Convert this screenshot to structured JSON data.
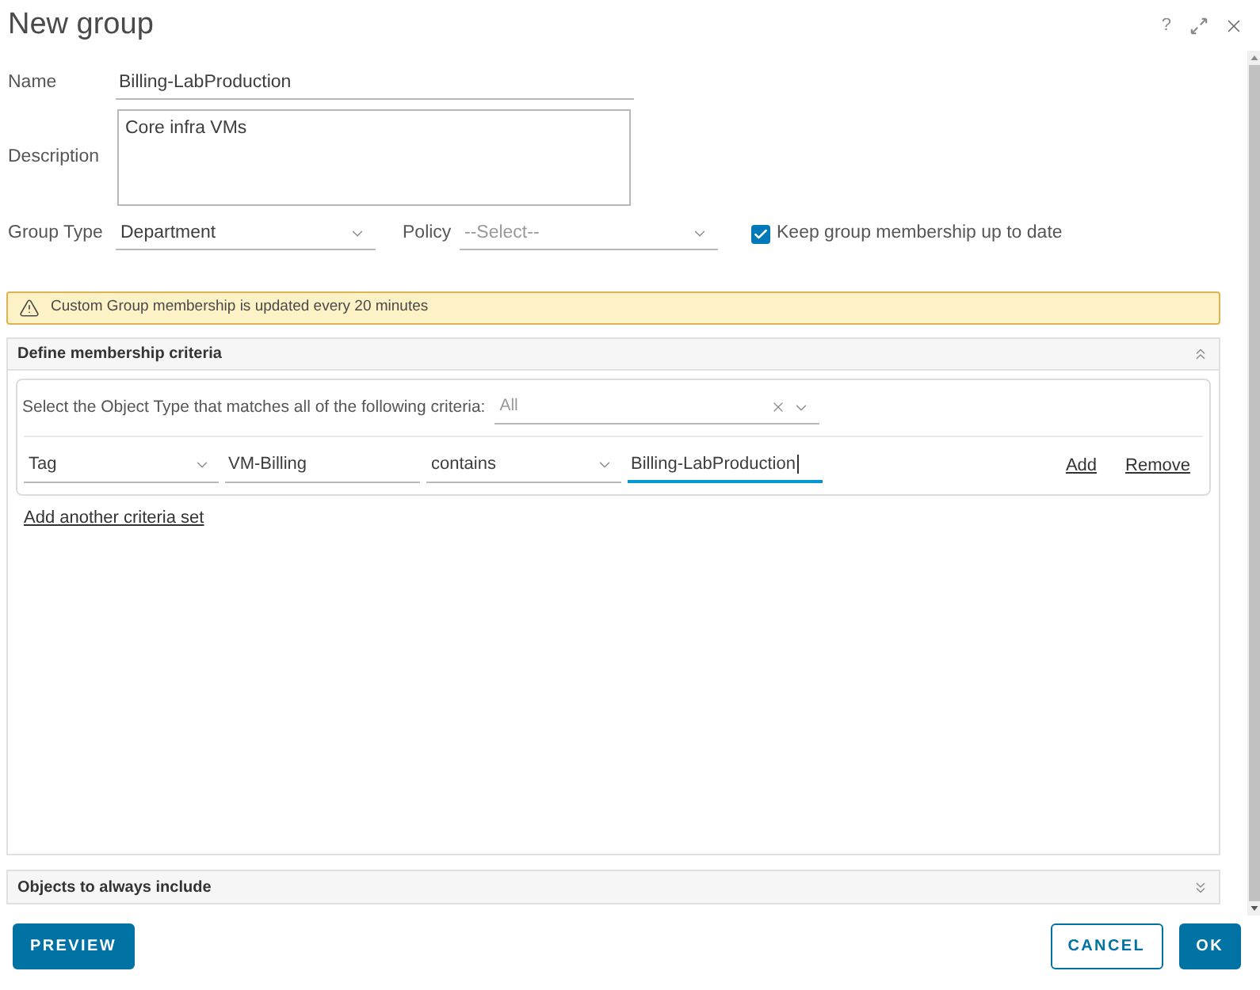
{
  "window": {
    "title": "New group",
    "help": "?"
  },
  "form": {
    "name": {
      "label": "Name",
      "value": "Billing-LabProduction"
    },
    "description": {
      "label": "Description",
      "value": "Core infra VMs"
    },
    "group_type": {
      "label": "Group Type",
      "value": "Department"
    },
    "policy": {
      "label": "Policy",
      "placeholder": "--Select--"
    },
    "keep_up_to_date": {
      "label": "Keep group membership up to date",
      "checked": true
    }
  },
  "alert": {
    "text": "Custom Group membership is updated every 20 minutes"
  },
  "sections": [
    {
      "title": "Define membership criteria",
      "expanded": true,
      "criteria_sets": [
        {
          "object_type": {
            "label": "Select the Object Type that matches all of the following criteria:",
            "placeholder": "All"
          },
          "criteria": [
            {
              "fields": [
                {
                  "kind": "select",
                  "value": "Tag",
                  "focused": false
                },
                {
                  "kind": "input",
                  "value": "VM-Billing",
                  "focused": false
                },
                {
                  "kind": "select",
                  "value": "contains",
                  "focused": false
                },
                {
                  "kind": "input",
                  "value": "Billing-LabProduction",
                  "focused": true
                }
              ],
              "actions": [
                "Add",
                "Remove"
              ]
            }
          ]
        }
      ],
      "add_link": "Add another criteria set"
    },
    {
      "title": "Objects to always include",
      "expanded": false
    }
  ],
  "footer": {
    "left_buttons": [
      {
        "label": "PREVIEW",
        "kind": "primary"
      }
    ],
    "right_buttons": [
      {
        "label": "CANCEL",
        "kind": "outline"
      },
      {
        "label": "OK",
        "kind": "primary"
      }
    ]
  }
}
